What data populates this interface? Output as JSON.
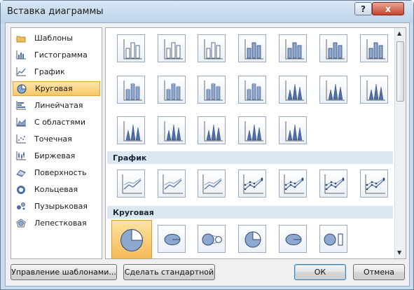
{
  "window": {
    "title": "Вставка диаграммы",
    "help_label": "?",
    "close_label": "x"
  },
  "chart_types": [
    {
      "label": "Шаблоны",
      "icon": "folder-icon",
      "selected": false
    },
    {
      "label": "Гистограмма",
      "icon": "column-chart-icon",
      "selected": false
    },
    {
      "label": "График",
      "icon": "line-chart-icon",
      "selected": false
    },
    {
      "label": "Круговая",
      "icon": "pie-chart-icon",
      "selected": true
    },
    {
      "label": "Линейчатая",
      "icon": "bar-chart-icon",
      "selected": false
    },
    {
      "label": "С областями",
      "icon": "area-chart-icon",
      "selected": false
    },
    {
      "label": "Точечная",
      "icon": "scatter-chart-icon",
      "selected": false
    },
    {
      "label": "Биржевая",
      "icon": "stock-chart-icon",
      "selected": false
    },
    {
      "label": "Поверхность",
      "icon": "surface-chart-icon",
      "selected": false
    },
    {
      "label": "Кольцевая",
      "icon": "doughnut-chart-icon",
      "selected": false
    },
    {
      "label": "Пузырьковая",
      "icon": "bubble-chart-icon",
      "selected": false
    },
    {
      "label": "Лепестковая",
      "icon": "radar-chart-icon",
      "selected": false
    }
  ],
  "gallery": {
    "sections": [
      "График",
      "Круговая"
    ]
  },
  "buttons": {
    "manage_templates": "Управление шаблонами...",
    "set_default": "Сделать стандартной",
    "ok": "ОК",
    "cancel": "Отмена"
  },
  "colors": {
    "accent_blue": "#4f6fa8",
    "selection_orange": "#f5b855"
  }
}
